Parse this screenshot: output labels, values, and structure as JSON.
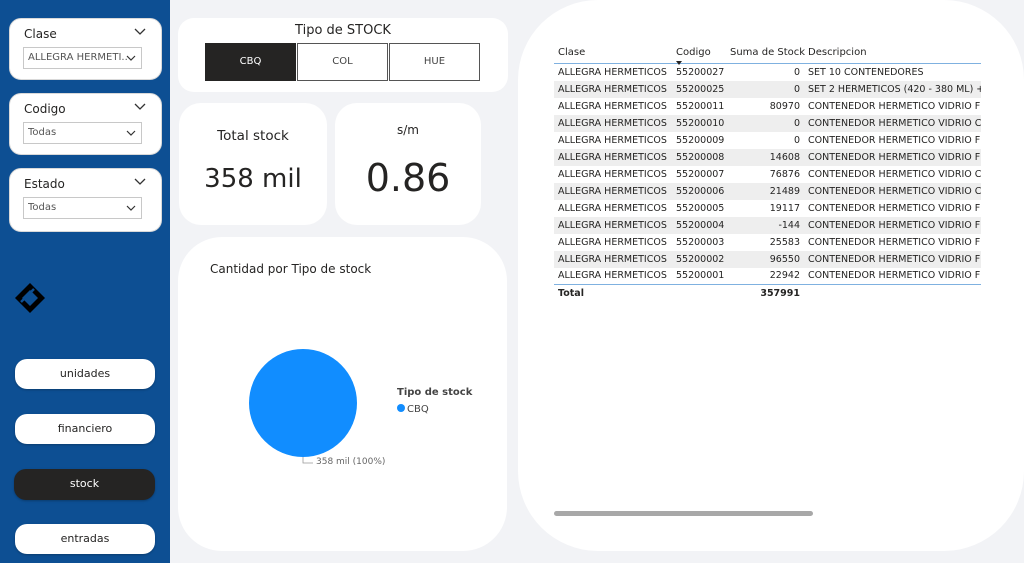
{
  "filters": [
    {
      "title": "Clase",
      "value": "ALLEGRA HERMETI..."
    },
    {
      "title": "Codigo",
      "value": "Todas"
    },
    {
      "title": "Estado",
      "value": "Todas"
    }
  ],
  "nav": [
    {
      "label": "unidades",
      "active": false
    },
    {
      "label": "financiero",
      "active": false
    },
    {
      "label": "stock",
      "active": true
    },
    {
      "label": "entradas",
      "active": false
    }
  ],
  "stock_type": {
    "title": "Tipo de STOCK",
    "options": [
      "CBQ",
      "COL",
      "HUE"
    ],
    "selected": "CBQ"
  },
  "kpis": {
    "total_stock": {
      "label": "Total stock",
      "value": "358 mil"
    },
    "sm": {
      "label": "s/m",
      "value": "0.86"
    }
  },
  "chart_data": {
    "type": "pie",
    "title": "Cantidad por Tipo de stock",
    "legend_title": "Tipo de stock",
    "slices": [
      {
        "name": "CBQ",
        "value": 357991,
        "label": "358 mil (100%)",
        "color": "#118dff"
      }
    ],
    "legend_placement": "right"
  },
  "table": {
    "columns": [
      "Clase",
      "Codigo",
      "Suma de Stock",
      "Descripcion"
    ],
    "rows": [
      [
        "ALLEGRA HERMETICOS",
        "55200027",
        "0",
        "SET 10 CONTENEDORES"
      ],
      [
        "ALLEGRA HERMETICOS",
        "55200025",
        "0",
        "SET 2 HERMETICOS (420 - 380 ML) +"
      ],
      [
        "ALLEGRA HERMETICOS",
        "55200011",
        "80970",
        "CONTENEDOR HERMETICO VIDRIO F"
      ],
      [
        "ALLEGRA HERMETICOS",
        "55200010",
        "0",
        "CONTENEDOR HERMETICO VIDRIO C"
      ],
      [
        "ALLEGRA HERMETICOS",
        "55200009",
        "0",
        "CONTENEDOR HERMETICO VIDRIO F"
      ],
      [
        "ALLEGRA HERMETICOS",
        "55200008",
        "14608",
        "CONTENEDOR HERMETICO VIDRIO F"
      ],
      [
        "ALLEGRA HERMETICOS",
        "55200007",
        "76876",
        "CONTENEDOR HERMETICO VIDRIO C"
      ],
      [
        "ALLEGRA HERMETICOS",
        "55200006",
        "21489",
        "CONTENEDOR HERMETICO VIDRIO C"
      ],
      [
        "ALLEGRA HERMETICOS",
        "55200005",
        "19117",
        "CONTENEDOR HERMETICO VIDRIO F"
      ],
      [
        "ALLEGRA HERMETICOS",
        "55200004",
        "-144",
        "CONTENEDOR HERMETICO VIDRIO F"
      ],
      [
        "ALLEGRA HERMETICOS",
        "55200003",
        "25583",
        "CONTENEDOR HERMETICO VIDRIO F"
      ],
      [
        "ALLEGRA HERMETICOS",
        "55200002",
        "96550",
        "CONTENEDOR HERMETICO VIDRIO F"
      ],
      [
        "ALLEGRA HERMETICOS",
        "55200001",
        "22942",
        "CONTENEDOR HERMETICO VIDRIO F"
      ]
    ],
    "total_label": "Total",
    "total_value": "357991",
    "sort_column": "Codigo",
    "sort_direction": "descending"
  },
  "colors": {
    "sidebar": "#0d4f93",
    "accent": "#118dff",
    "active": "#252423"
  },
  "icons": {
    "chevron": "chevron-down-icon",
    "logo": "diamond-logo-icon"
  }
}
